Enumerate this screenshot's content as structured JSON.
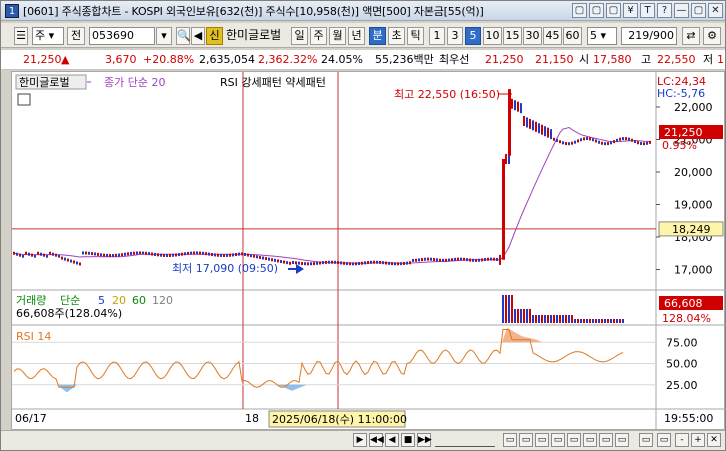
{
  "window": {
    "title": "[0601] 주식종합차트 - KOSPI 외국인보유[632(천)] 주식수[10,958(천)] 액면[500] 자본금[55(억)]",
    "icon_number": "1",
    "buttons": [
      "▢",
      "▢",
      "▢",
      "¥",
      "T",
      "?",
      "—",
      "▢",
      "✕"
    ]
  },
  "toolbar": {
    "market": "주",
    "market_btn": "전",
    "code": "053690",
    "new_label": "신",
    "name": "한미글로벌",
    "periods": [
      "일",
      "주",
      "월",
      "년",
      "분",
      "초",
      "틱"
    ],
    "active_period": "분",
    "intervals": [
      "1",
      "3",
      "5",
      "10",
      "15",
      "30",
      "45",
      "60"
    ],
    "active_interval": "5",
    "count": "5",
    "page": "219/900"
  },
  "quote": {
    "price": "21,250",
    "arrow": "▲",
    "change": "3,670",
    "rate": "+20.88%",
    "volume": "2,635,054",
    "vol_rate": "2,362.32%",
    "turnover": "24.05%",
    "amount": "55,236백만",
    "best": "최우선",
    "ask": "21,250",
    "bid": "21,150",
    "open_label": "시",
    "open": "17,580",
    "high_label": "고",
    "high": "22,550",
    "low_label": "저",
    "low": "1"
  },
  "price_panel": {
    "name": "한미글로벌",
    "ma_label": "종가 단순 20",
    "rsi_label": "RSI 강세패턴 약세패턴",
    "max_label": "최고 22,550 (16:50)",
    "min_label": "최저 17,090 (09:50)",
    "lc": "LC:24,34",
    "hc": "HC:-5,76",
    "current_price": "21,250",
    "current_pct": "0.95%",
    "ref_price": "18,249",
    "axis_ticks": [
      "22,000",
      "21,000",
      "20,000",
      "19,000",
      "18,000",
      "17,000"
    ],
    "axis_values": [
      22000,
      21000,
      20000,
      19000,
      18000,
      17000
    ],
    "ref_value": 18249
  },
  "volume_panel": {
    "title": "거래량",
    "ma_prefix": "단순",
    "ma_values": [
      "5",
      "20",
      "60",
      "120"
    ],
    "ma_colors": [
      "#1a3cc8",
      "#c8a000",
      "#0a8a0a",
      "#808080"
    ],
    "volume_text": "66,608주(128.04%)",
    "current_vol": "66,608",
    "current_pct": "128.04%"
  },
  "rsi_panel": {
    "title": "RSI 14",
    "axis_ticks": [
      "75.00",
      "50.00",
      "25.00"
    ],
    "axis_values": [
      75,
      50,
      25
    ]
  },
  "xaxis": {
    "date_left": "06/17",
    "date_mid": "18",
    "cursor_label": "2025/06/18(수) 11:00:00",
    "time_right": "19:55:00"
  },
  "colors": {
    "up": "#d00000",
    "down": "#1a3cc8",
    "ma": "#a040c0",
    "rsi": "#e07820",
    "cursor": "#c83030",
    "highlight": "#fff5a8"
  },
  "statusbar": {
    "nav_buttons": [
      "▶",
      "◀◀",
      "◀",
      "■",
      "▶▶"
    ],
    "zoom_buttons": [
      "-",
      "+"
    ]
  }
}
